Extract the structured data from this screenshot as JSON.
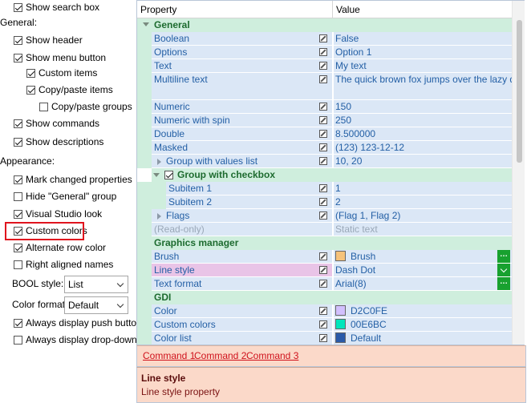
{
  "options": {
    "show_search_box": {
      "label": "Show search box",
      "checked": true
    },
    "general_label": "General:",
    "show_header": {
      "label": "Show header",
      "checked": true
    },
    "show_menu_button": {
      "label": "Show menu button",
      "checked": true
    },
    "custom_items": {
      "label": "Custom items",
      "checked": true
    },
    "copy_paste_items": {
      "label": "Copy/paste items",
      "checked": true
    },
    "copy_paste_groups": {
      "label": "Copy/paste groups",
      "checked": false
    },
    "show_commands": {
      "label": "Show commands",
      "checked": true
    },
    "show_descriptions": {
      "label": "Show descriptions",
      "checked": true
    },
    "appearance_label": "Appearance:",
    "mark_changed": {
      "label": "Mark changed properties",
      "checked": true
    },
    "hide_general": {
      "label": "Hide \"General\" group",
      "checked": false
    },
    "visual_studio_look": {
      "label": "Visual Studio look",
      "checked": true
    },
    "custom_colors": {
      "label": "Custom colors",
      "checked": true
    },
    "alternate_row_color": {
      "label": "Alternate row color",
      "checked": true
    },
    "right_aligned_names": {
      "label": "Right aligned names",
      "checked": false
    },
    "bool_style": {
      "label": "BOOL style:",
      "value": "List"
    },
    "color_format": {
      "label": "Color format:",
      "value": "Default"
    },
    "always_push_buttons": {
      "label": "Always display push buttons",
      "checked": true
    },
    "always_dropdowns": {
      "label": "Always display drop-downs",
      "checked": false
    }
  },
  "grid": {
    "header_property": "Property",
    "header_value": "Value",
    "categories": {
      "general": "General",
      "group_with_checkbox": "Group with checkbox",
      "graphics_manager": "Graphics manager",
      "gdi": "GDI"
    },
    "rows": {
      "boolean": {
        "name": "Boolean",
        "value": "False"
      },
      "options": {
        "name": "Options",
        "value": "Option 1"
      },
      "text": {
        "name": "Text",
        "value": "My text"
      },
      "multiline": {
        "name": "Multiline text",
        "value": "The quick brown fox jumps over the lazy dog"
      },
      "numeric": {
        "name": "Numeric",
        "value": "150"
      },
      "numeric_spin": {
        "name": "Numeric with spin",
        "value": "250"
      },
      "double": {
        "name": "Double",
        "value": "8.500000"
      },
      "masked": {
        "name": "Masked",
        "value": "(123) 123-12-12"
      },
      "group_values_list": {
        "name": "Group with values list",
        "value": "10, 20"
      },
      "subitem1": {
        "name": "Subitem 1",
        "value": "1"
      },
      "subitem2": {
        "name": "Subitem 2",
        "value": "2"
      },
      "flags": {
        "name": "Flags",
        "value": "(Flag 1, Flag 2)"
      },
      "readonly": {
        "name": "(Read-only)",
        "value": "Static text"
      },
      "brush": {
        "name": "Brush",
        "value": "Brush"
      },
      "line_style": {
        "name": "Line style",
        "value": "Dash Dot"
      },
      "text_format": {
        "name": "Text format",
        "value": "Arial(8)"
      },
      "color": {
        "name": "Color",
        "value": "D2C0FE"
      },
      "custom_colors": {
        "name": "Custom colors",
        "value": "00E6BC"
      },
      "color_list": {
        "name": "Color list",
        "value": "Default"
      }
    },
    "swatches": {
      "color": "#D2C0FE",
      "custom_colors": "#00E6BC",
      "color_list": "#2a5aa8",
      "brush": "#f6c27a"
    }
  },
  "commands": [
    "Command 1",
    "Command 2",
    "Command 3"
  ],
  "description": {
    "title": "Line style",
    "text": "Line style property"
  }
}
